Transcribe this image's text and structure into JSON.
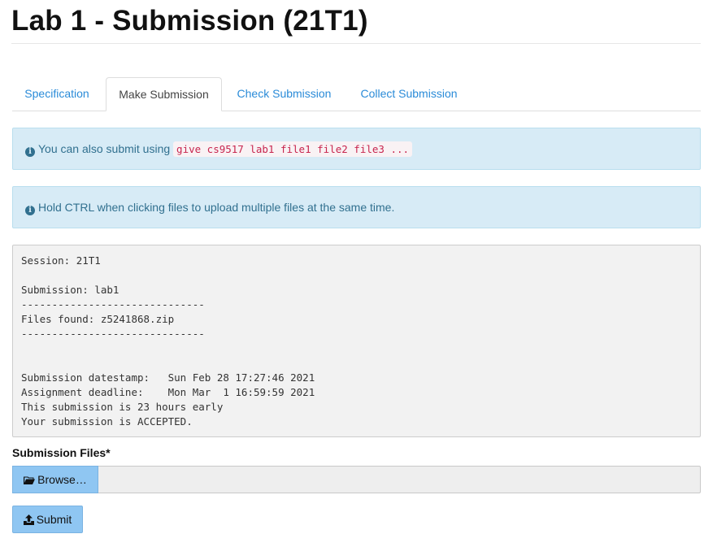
{
  "page": {
    "title": "Lab 1 - Submission (21T1)"
  },
  "tabs": [
    {
      "label": "Specification",
      "active": false
    },
    {
      "label": "Make Submission",
      "active": true
    },
    {
      "label": "Check Submission",
      "active": false
    },
    {
      "label": "Collect Submission",
      "active": false
    }
  ],
  "alerts": {
    "give_text": "You can also submit using",
    "give_command": "give cs9517 lab1 file1 file2 file3 ...",
    "ctrl_text": "Hold CTRL when clicking files to upload multiple files at the same time."
  },
  "output": {
    "lines": [
      "Session: 21T1",
      "",
      "Submission: lab1",
      "------------------------------",
      "Files found: z5241868.zip",
      "------------------------------",
      "",
      "",
      "Submission datestamp:   Sun Feb 28 17:27:46 2021",
      "Assignment deadline:    Mon Mar  1 16:59:59 2021",
      "This submission is 23 hours early",
      "Your submission is ACCEPTED."
    ]
  },
  "form": {
    "files_label": "Submission Files*",
    "browse_label": "Browse…",
    "file_value": "",
    "submit_label": "Submit"
  },
  "icons": {
    "info": "info-circle-icon",
    "browse": "folder-open-icon",
    "submit": "upload-icon"
  },
  "colors": {
    "link": "#2a8bd8",
    "alert_bg": "#d7ebf6",
    "alert_text": "#31708f",
    "button_bg": "#8fc6f2",
    "code_text": "#c7254e"
  }
}
